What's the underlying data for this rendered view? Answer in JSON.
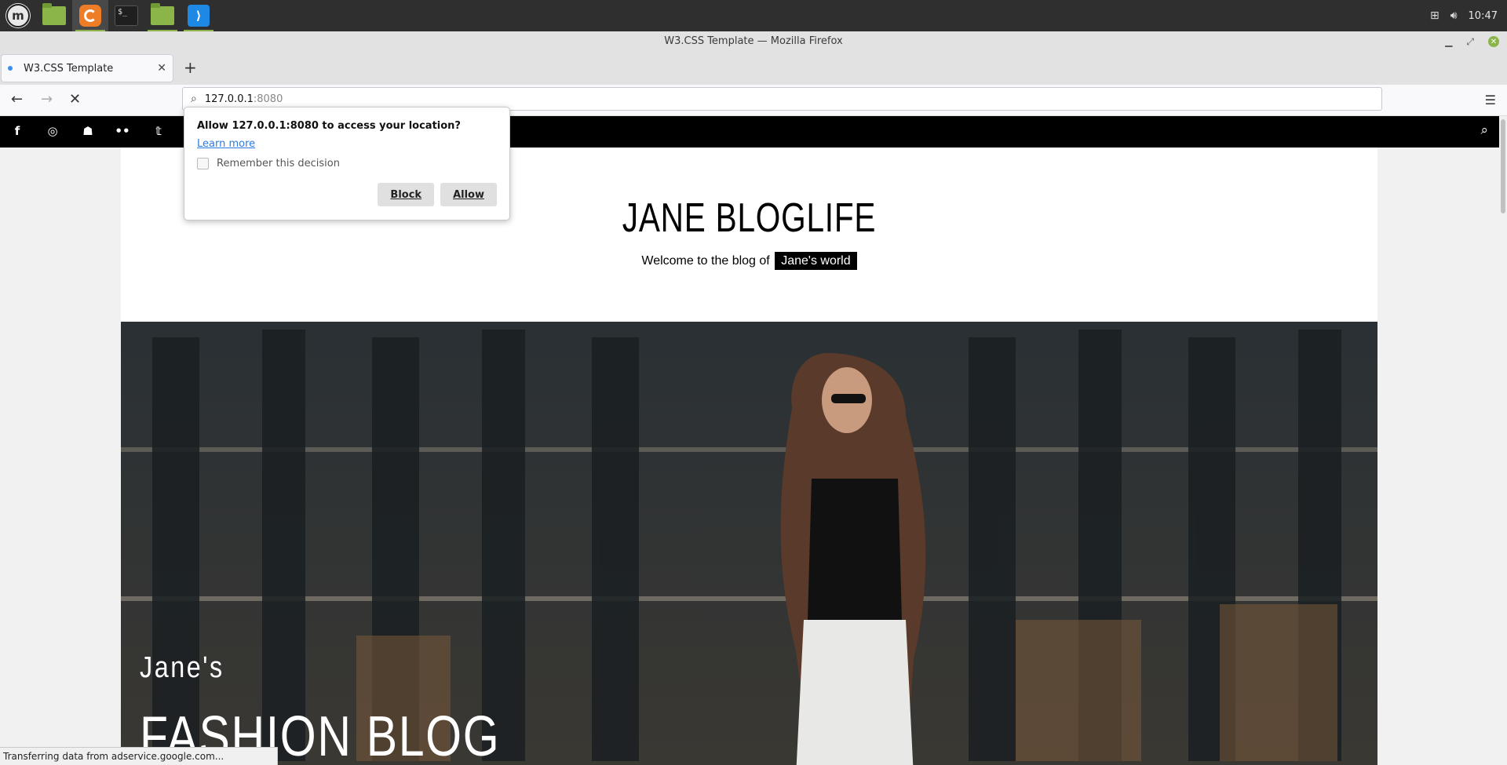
{
  "taskbar": {
    "apps": [
      {
        "name": "mint-menu-icon"
      },
      {
        "name": "files-app-icon"
      },
      {
        "name": "firefox-app-icon"
      },
      {
        "name": "terminal-app-icon"
      },
      {
        "name": "folder-app-icon"
      },
      {
        "name": "vscode-app-icon"
      }
    ],
    "clock": "10:47",
    "terminal_glyph": "$_"
  },
  "window": {
    "title": "W3.CSS Template — Mozilla Firefox"
  },
  "tabs": [
    {
      "label": "W3.CSS Template",
      "close": "✕"
    }
  ],
  "navbar": {
    "url_host": "127.0.0.1",
    "url_port": ":8080"
  },
  "popup": {
    "question": "Allow 127.0.0.1:8080 to access your location?",
    "learn_more": "Learn more",
    "remember": "Remember this decision",
    "remember_checked": false,
    "block_label": "Block",
    "allow_label": "Allow"
  },
  "site": {
    "social_icons": [
      "facebook-icon",
      "instagram-icon",
      "snapchat-icon",
      "flickr-icon",
      "twitter-icon"
    ],
    "title": "JANE BLOGLIFE",
    "subtitle_prefix": "Welcome to the blog of",
    "subtitle_tag": "Jane's world",
    "hero_small": "Jane's",
    "hero_big": "FASHION BLOG"
  },
  "status": {
    "text": "Transferring data from adservice.google.com..."
  },
  "colors": {
    "accent_link": "#2a7ae2",
    "topbar": "#000000",
    "taskbar": "#2f2f2f"
  }
}
